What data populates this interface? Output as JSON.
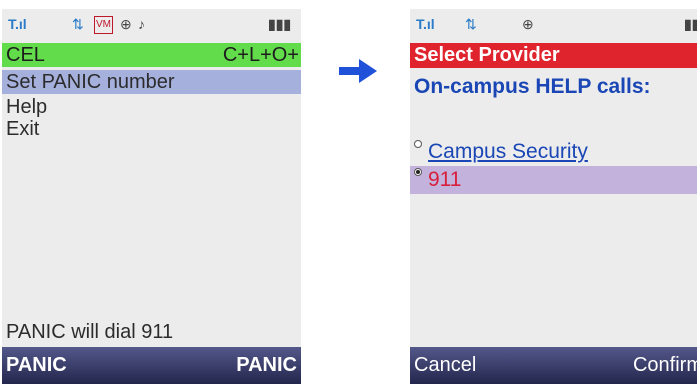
{
  "left": {
    "title": "CEL",
    "title_right": "C+L+O+",
    "menu": [
      "Set PANIC number",
      "Help",
      "Exit"
    ],
    "info": "PANIC will dial 911",
    "softkey_left": "PANIC",
    "softkey_right": "PANIC"
  },
  "right": {
    "title": "Select Provider",
    "heading": "On-campus HELP calls:",
    "options": [
      "Campus Security",
      "911"
    ],
    "selected_option": "911",
    "softkey_left": "Cancel",
    "softkey_right": "Confirm"
  },
  "colors": {
    "left_title_bg": "#63dc4c",
    "left_selection_bg": "#a6b0dc",
    "right_title_bg": "#e0242e",
    "right_heading": "#1a47b5",
    "right_selected_bg": "#c3b2dc",
    "arrow": "#1f52d8"
  },
  "icons": [
    "signal-icon",
    "data-transfer-icon",
    "voicemail-icon",
    "gps-icon",
    "ringtone-icon",
    "battery-icon",
    "arrow-right-icon"
  ]
}
